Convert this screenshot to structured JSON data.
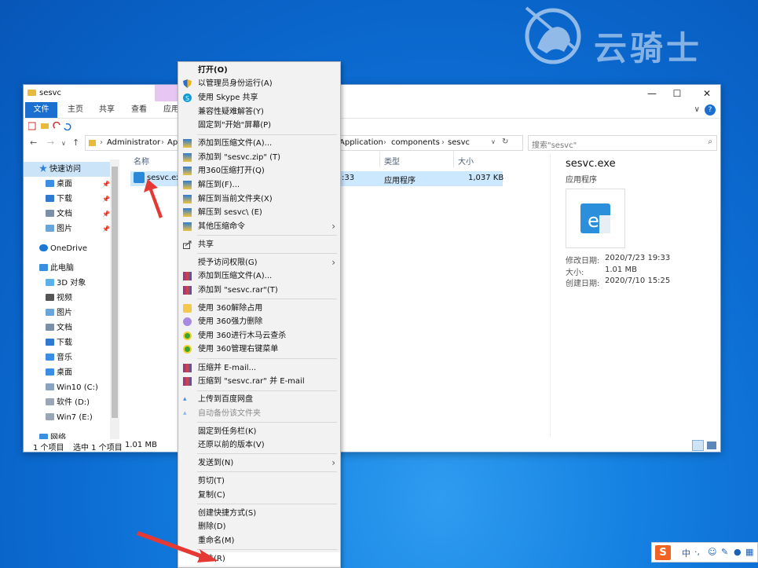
{
  "watermark": {
    "text": "云骑士"
  },
  "window": {
    "title": "sesvc",
    "controls": {
      "minimize": "—",
      "maximize": "☐",
      "close": "✕"
    },
    "ribbon_tabs": {
      "file": "文件",
      "home": "主页",
      "share": "共享",
      "view": "查看",
      "app": "应用"
    },
    "help": "?",
    "collapse": "∨",
    "address_left": [
      "Administrator",
      "Ap"
    ],
    "address_right": [
      "Application",
      "components",
      "sesvc"
    ],
    "search_placeholder": "搜索\"sesvc\"",
    "nav": {
      "quick_access": "快速访问",
      "desktop": "桌面",
      "downloads": "下载",
      "documents": "文档",
      "pictures": "图片",
      "onedrive": "OneDrive",
      "this_pc": "此电脑",
      "objects3d": "3D 对象",
      "videos": "视频",
      "pictures2": "图片",
      "documents2": "文档",
      "downloads2": "下载",
      "music": "音乐",
      "desktop2": "桌面",
      "drive_c": "Win10 (C:)",
      "drive_d": "软件 (D:)",
      "drive_e": "Win7 (E:)",
      "network": "网络"
    },
    "columns": {
      "name": "名称",
      "type": "类型",
      "size": "大小"
    },
    "file": {
      "name": "sesvc.exe",
      "time": ":33",
      "type": "应用程序",
      "size": "1,037 KB"
    },
    "preview": {
      "name": "sesvc.exe",
      "type": "应用程序",
      "modified_label": "修改日期:",
      "modified": "2020/7/23 19:33",
      "size_label": "大小:",
      "size": "1.01 MB",
      "created_label": "创建日期:",
      "created": "2020/7/10 15:25"
    },
    "status": {
      "count": "1 个项目",
      "selected": "选中 1 个项目",
      "size": "1.01 MB"
    }
  },
  "menu": {
    "open": "打开(O)",
    "run_admin": "以管理员身份运行(A)",
    "skype": "使用 Skype 共享",
    "compat": "兼容性疑难解答(Y)",
    "pin_start": "固定到\"开始\"屏幕(P)",
    "add_archive": "添加到压缩文件(A)...",
    "add_zip": "添加到 \"sesvc.zip\" (T)",
    "open_360": "用360压缩打开(Q)",
    "extract": "解压到(F)...",
    "extract_here": "解压到当前文件夹(X)",
    "extract_sesvc": "解压到 sesvc\\ (E)",
    "other_compress": "其他压缩命令",
    "share": "共享",
    "give_access": "授予访问权限(G)",
    "rar_add": "添加到压缩文件(A)...",
    "rar_add_named": "添加到 \"sesvc.rar\"(T)",
    "unlock_360": "使用 360解除占用",
    "force_delete_360": "使用 360强力删除",
    "trojan_360": "使用 360进行木马云查杀",
    "manage_360": "使用 360管理右键菜单",
    "email": "压缩并 E-mail...",
    "email_rar": "压缩到 \"sesvc.rar\" 并 E-mail",
    "baidu_upload": "上传到百度网盘",
    "baidu_backup": "自动备份该文件夹",
    "pin_taskbar": "固定到任务栏(K)",
    "restore": "还原以前的版本(V)",
    "send_to": "发送到(N)",
    "cut": "剪切(T)",
    "copy": "复制(C)",
    "shortcut": "创建快捷方式(S)",
    "delete": "删除(D)",
    "rename": "重命名(M)",
    "properties": "属性(R)"
  },
  "ime": {
    "logo": "S",
    "lang": "中"
  },
  "colors": {
    "accent": "#1a6fd0",
    "selection": "#cce8ff",
    "arrow": "#e53935"
  }
}
